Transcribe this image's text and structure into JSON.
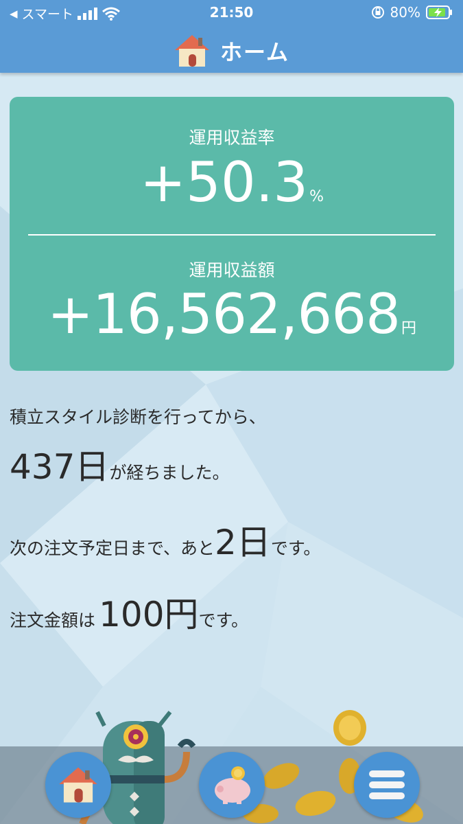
{
  "status_bar": {
    "carrier": "スマート",
    "time": "21:50",
    "battery": "80%"
  },
  "header": {
    "title": "ホーム"
  },
  "card": {
    "rate_label": "運用収益率",
    "rate_value": "+50.3",
    "rate_unit": "%",
    "amount_label": "運用収益額",
    "amount_value": "+16,562,668",
    "amount_unit": "円"
  },
  "messages": {
    "line1": "積立スタイル診断を行ってから、",
    "days_elapsed": "437日",
    "days_suffix": "が経ちました。",
    "next_order_prefix": "次の注文予定日まで、あと",
    "days_remaining": "2日",
    "next_order_suffix": "です。",
    "order_prefix": "注文金額は",
    "order_amount": "100円",
    "order_suffix": "です。"
  },
  "colors": {
    "header": "#5a9bd6",
    "card": "#5bbaa9",
    "nav_button": "#4a93d4"
  },
  "nav": {
    "home_icon": "house-icon",
    "savings_icon": "piggy-bank-icon",
    "menu_icon": "menu-icon"
  }
}
